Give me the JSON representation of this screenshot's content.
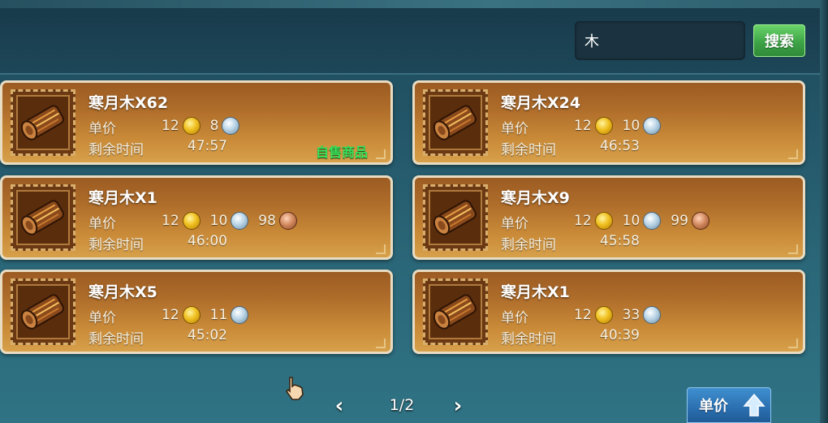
{
  "search": {
    "value": "木",
    "button_label": "搜索"
  },
  "labels": {
    "price": "单价",
    "time_left": "剩余时间"
  },
  "listings": [
    {
      "name": "寒月木X62",
      "gold": "12",
      "silver": "8",
      "copper": null,
      "time": "47:57",
      "tag": "自售商品"
    },
    {
      "name": "寒月木X24",
      "gold": "12",
      "silver": "10",
      "copper": null,
      "time": "46:53",
      "tag": null
    },
    {
      "name": "寒月木X1",
      "gold": "12",
      "silver": "10",
      "copper": "98",
      "time": "46:00",
      "tag": null
    },
    {
      "name": "寒月木X9",
      "gold": "12",
      "silver": "10",
      "copper": "99",
      "time": "45:58",
      "tag": null
    },
    {
      "name": "寒月木X5",
      "gold": "12",
      "silver": "11",
      "copper": null,
      "time": "45:02",
      "tag": null
    },
    {
      "name": "寒月木X1",
      "gold": "12",
      "silver": "33",
      "copper": null,
      "time": "40:39",
      "tag": null
    }
  ],
  "pagination": {
    "text": "1/2",
    "prev_icon": "chevron-left-icon",
    "next_icon": "chevron-right-icon"
  },
  "sort": {
    "label": "单价",
    "icon": "sort-up-arrow-icon"
  },
  "colors": {
    "card_border": "#e8dcc3",
    "self_sell_tag": "#38e05a",
    "search_button": "#3ea447",
    "sort_button": "#2b6fb0"
  }
}
